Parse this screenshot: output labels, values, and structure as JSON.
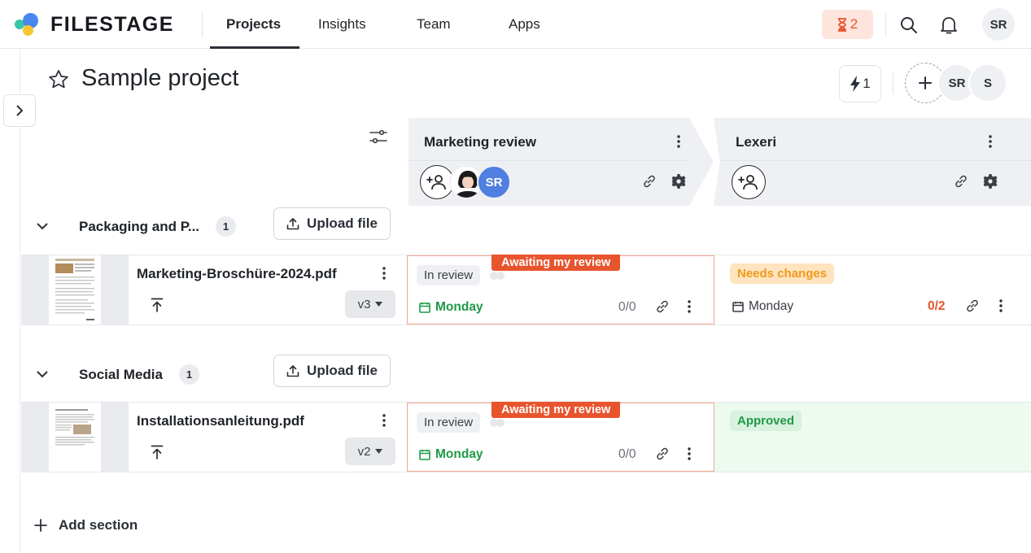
{
  "app": {
    "name": "FILESTAGE"
  },
  "nav": {
    "projects": "Projects",
    "insights": "Insights",
    "team": "Team",
    "apps": "Apps"
  },
  "header": {
    "pending_count": "2",
    "user_initials": "SR"
  },
  "project": {
    "title": "Sample project",
    "automations_count": "1",
    "members": [
      "SR",
      "S"
    ]
  },
  "steps": [
    {
      "name": "Marketing review",
      "reviewer_initials": "SR"
    },
    {
      "name": "Lexeri"
    }
  ],
  "sections": [
    {
      "name": "Packaging and P...",
      "count": "1",
      "upload_label": "Upload file",
      "file": {
        "name": "Marketing-Broschüre-2024.pdf",
        "version": "v3",
        "marketing": {
          "status": "In review",
          "badge": "Awaiting my review",
          "due": "Monday",
          "comments": "0/0"
        },
        "lexeri": {
          "status": "Needs changes",
          "due": "Monday",
          "comments": "0/2"
        }
      }
    },
    {
      "name": "Social Media",
      "count": "1",
      "upload_label": "Upload file",
      "file": {
        "name": "Installationsanleitung.pdf",
        "version": "v2",
        "marketing": {
          "status": "In review",
          "badge": "Awaiting my review",
          "due": "Monday",
          "comments": "0/0"
        },
        "lexeri": {
          "status": "Approved"
        }
      }
    }
  ],
  "add_section_label": "Add section",
  "colors": {
    "accent": "#e8542d",
    "green": "#1e9a45",
    "amber": "#f09a1c",
    "avatar_blue": "#4f7fe0"
  },
  "icons": [
    "star-icon",
    "hourglass-icon",
    "search-icon",
    "bell-icon",
    "bolt-icon",
    "plus-icon",
    "chevron-right-icon",
    "chevron-down-icon",
    "filter-settings-icon",
    "more-vertical-icon",
    "add-user-icon",
    "link-icon",
    "gear-icon",
    "upload-icon",
    "calendar-icon",
    "upload-version-icon"
  ]
}
